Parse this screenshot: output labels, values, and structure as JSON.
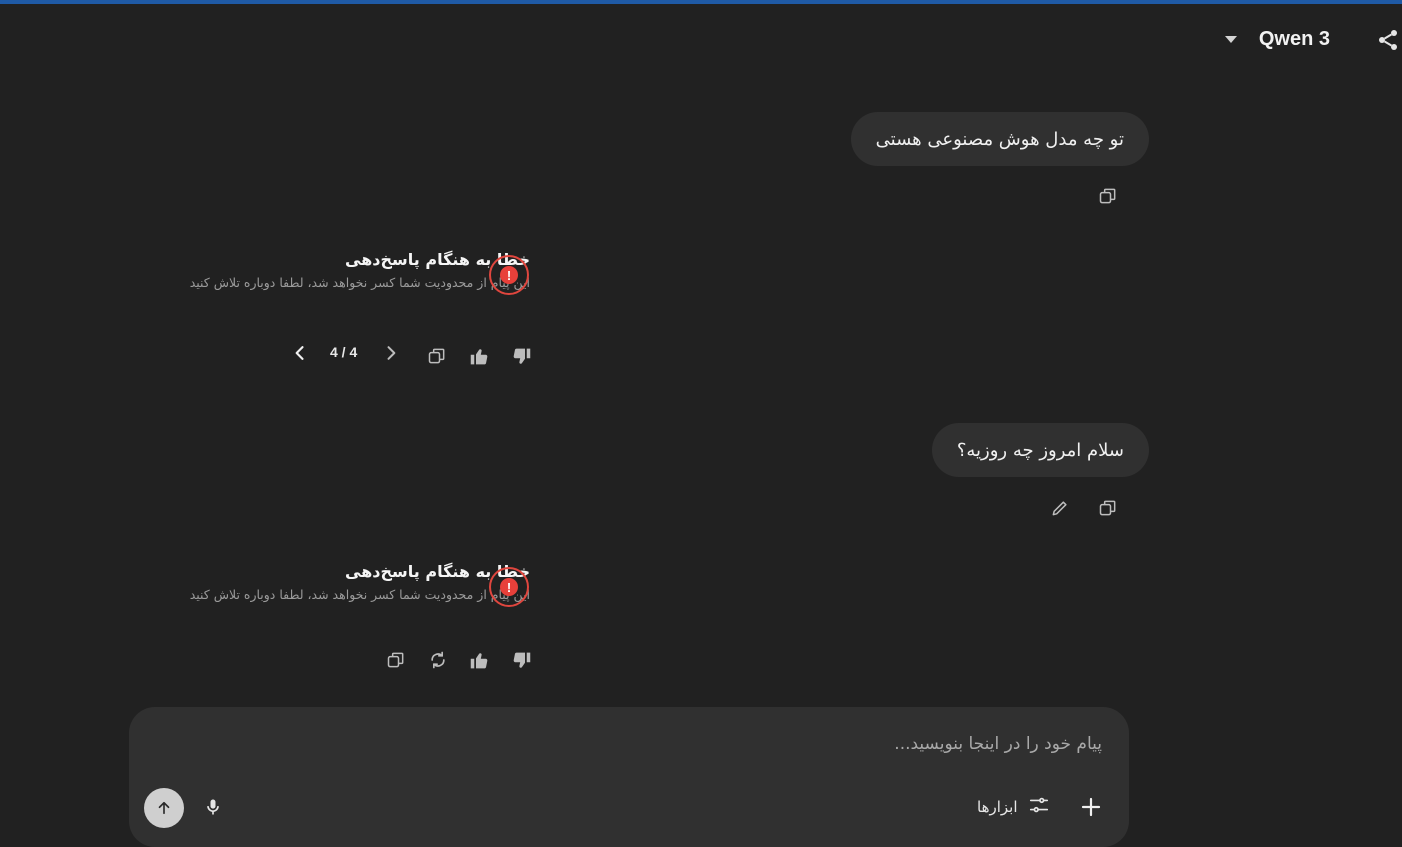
{
  "header": {
    "model_name": "Qwen 3",
    "caret_icon": "chevron-down-icon",
    "share_icon": "share-icon"
  },
  "messages": [
    {
      "role": "user",
      "text": "تو چه مدل هوش مصنوعی هستی"
    },
    {
      "role": "assistant",
      "error_title": "خطا به هنگام پاسخ‌دهی",
      "error_text": "این پیام از محدودیت شما کسر نخواهد شد، لطفا دوباره تلاش کنید",
      "pager": "4 / 4"
    },
    {
      "role": "user",
      "text": "سلام امروز چه روزیه؟"
    },
    {
      "role": "assistant",
      "error_title": "خطا به هنگام پاسخ‌دهی",
      "error_text": "این پیام از محدودیت شما کسر نخواهد شد، لطفا دوباره تلاش کنید"
    }
  ],
  "composer": {
    "placeholder": "پیام خود را در اینجا بنویسید...",
    "tools_label": "ابزارها"
  },
  "colors": {
    "background": "#212121",
    "bubble": "#303030",
    "error": "#e8403a",
    "accent_top": "#1f5aa6"
  }
}
